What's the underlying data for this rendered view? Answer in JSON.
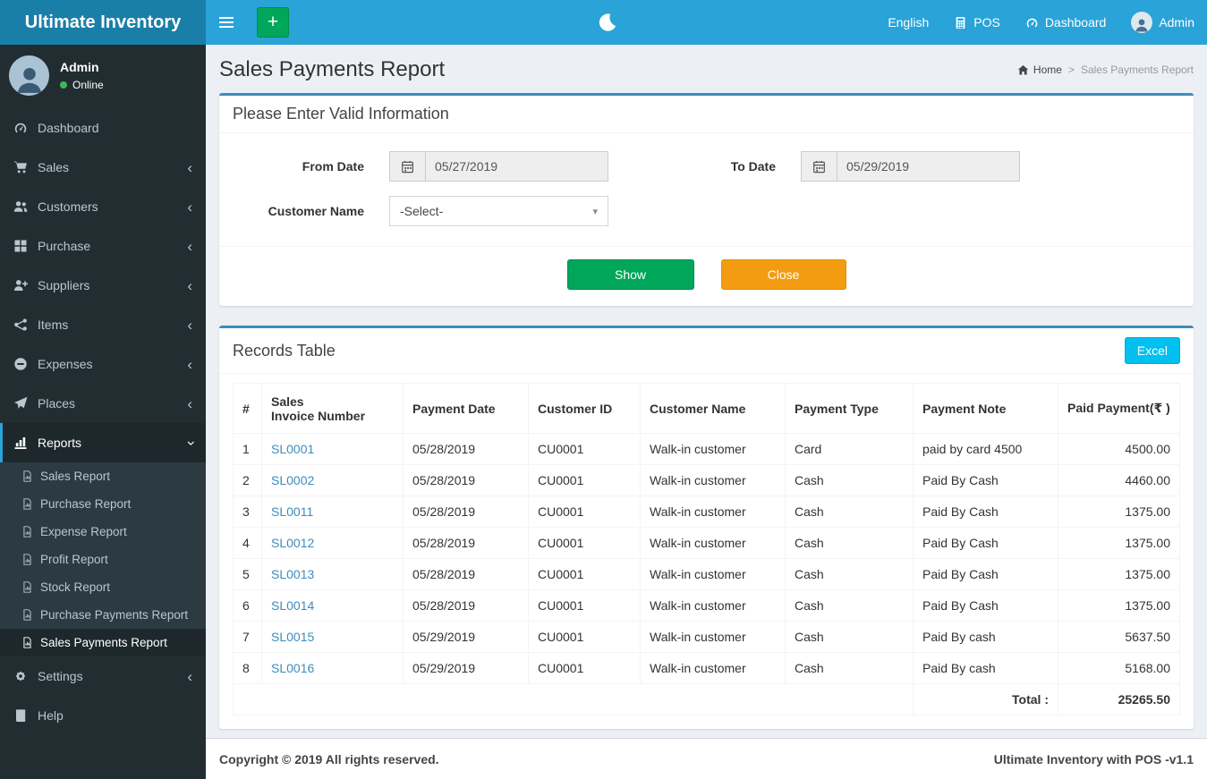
{
  "colors": {
    "navbar": "#29a3d8",
    "brand_bg": "#1a7fa8",
    "primary": "#3c8dbc",
    "success": "#00a65a",
    "warning": "#f39c12",
    "info": "#00c0ef",
    "sidebar_bg": "#222d32",
    "online_dot": "#3db94d",
    "link": "#3c8dbc"
  },
  "brand": {
    "title": "Ultimate Inventory"
  },
  "topbar": {
    "add_icon": "+",
    "language_label": "English",
    "pos_label": "POS",
    "dashboard_label": "Dashboard",
    "user_label": "Admin"
  },
  "sidebar": {
    "user_name": "Admin",
    "user_status": "Online",
    "chevron": "‹",
    "items": [
      {
        "label": "Dashboard",
        "icon": "gauge-icon"
      },
      {
        "label": "Sales",
        "icon": "cart-icon"
      },
      {
        "label": "Customers",
        "icon": "users-icon"
      },
      {
        "label": "Purchase",
        "icon": "grid-icon"
      },
      {
        "label": "Suppliers",
        "icon": "user-plus-icon"
      },
      {
        "label": "Items",
        "icon": "share-icon"
      },
      {
        "label": "Expenses",
        "icon": "minus-circle-icon"
      },
      {
        "label": "Places",
        "icon": "paper-plane-icon"
      },
      {
        "label": "Reports",
        "icon": "bar-chart-icon"
      },
      {
        "label": "Settings",
        "icon": "gears-icon"
      },
      {
        "label": "Help",
        "icon": "book-icon"
      }
    ],
    "reports_submenu": [
      {
        "label": "Sales Report"
      },
      {
        "label": "Purchase Report"
      },
      {
        "label": "Expense Report"
      },
      {
        "label": "Profit Report"
      },
      {
        "label": "Stock Report"
      },
      {
        "label": "Purchase Payments Report"
      },
      {
        "label": "Sales Payments Report"
      }
    ]
  },
  "page": {
    "title": "Sales Payments Report",
    "breadcrumb": {
      "home": "Home",
      "separator": ">",
      "current": "Sales Payments Report"
    }
  },
  "filter": {
    "title": "Please Enter Valid Information",
    "from_date": {
      "label": "From Date",
      "value": "05/27/2019"
    },
    "to_date": {
      "label": "To Date",
      "value": "05/29/2019"
    },
    "customer": {
      "label": "Customer Name",
      "value": "-Select-",
      "caret": "▾"
    },
    "show_button": "Show",
    "close_button": "Close"
  },
  "records": {
    "title": "Records Table",
    "excel_button": "Excel",
    "columns": [
      "#",
      "Sales\nInvoice Number",
      "Payment Date",
      "Customer ID",
      "Customer Name",
      "Payment Type",
      "Payment Note",
      "Paid Payment(₹ )"
    ],
    "rows": [
      {
        "num": "1",
        "invoice": "SL0001",
        "date": "05/28/2019",
        "customer_id": "CU0001",
        "customer_name": "Walk-in customer",
        "type": "Card",
        "note": "paid by card 4500",
        "amount": "4500.00"
      },
      {
        "num": "2",
        "invoice": "SL0002",
        "date": "05/28/2019",
        "customer_id": "CU0001",
        "customer_name": "Walk-in customer",
        "type": "Cash",
        "note": "Paid By Cash",
        "amount": "4460.00"
      },
      {
        "num": "3",
        "invoice": "SL0011",
        "date": "05/28/2019",
        "customer_id": "CU0001",
        "customer_name": "Walk-in customer",
        "type": "Cash",
        "note": "Paid By Cash",
        "amount": "1375.00"
      },
      {
        "num": "4",
        "invoice": "SL0012",
        "date": "05/28/2019",
        "customer_id": "CU0001",
        "customer_name": "Walk-in customer",
        "type": "Cash",
        "note": "Paid By Cash",
        "amount": "1375.00"
      },
      {
        "num": "5",
        "invoice": "SL0013",
        "date": "05/28/2019",
        "customer_id": "CU0001",
        "customer_name": "Walk-in customer",
        "type": "Cash",
        "note": "Paid By Cash",
        "amount": "1375.00"
      },
      {
        "num": "6",
        "invoice": "SL0014",
        "date": "05/28/2019",
        "customer_id": "CU0001",
        "customer_name": "Walk-in customer",
        "type": "Cash",
        "note": "Paid By Cash",
        "amount": "1375.00"
      },
      {
        "num": "7",
        "invoice": "SL0015",
        "date": "05/29/2019",
        "customer_id": "CU0001",
        "customer_name": "Walk-in customer",
        "type": "Cash",
        "note": "Paid By cash",
        "amount": "5637.50"
      },
      {
        "num": "8",
        "invoice": "SL0016",
        "date": "05/29/2019",
        "customer_id": "CU0001",
        "customer_name": "Walk-in customer",
        "type": "Cash",
        "note": "Paid By cash",
        "amount": "5168.00"
      }
    ],
    "total_label": "Total :",
    "total_value": "25265.50"
  },
  "footer": {
    "copyright": "Copyright © 2019 All rights reserved.",
    "version": "Ultimate Inventory with POS -v1.1"
  }
}
